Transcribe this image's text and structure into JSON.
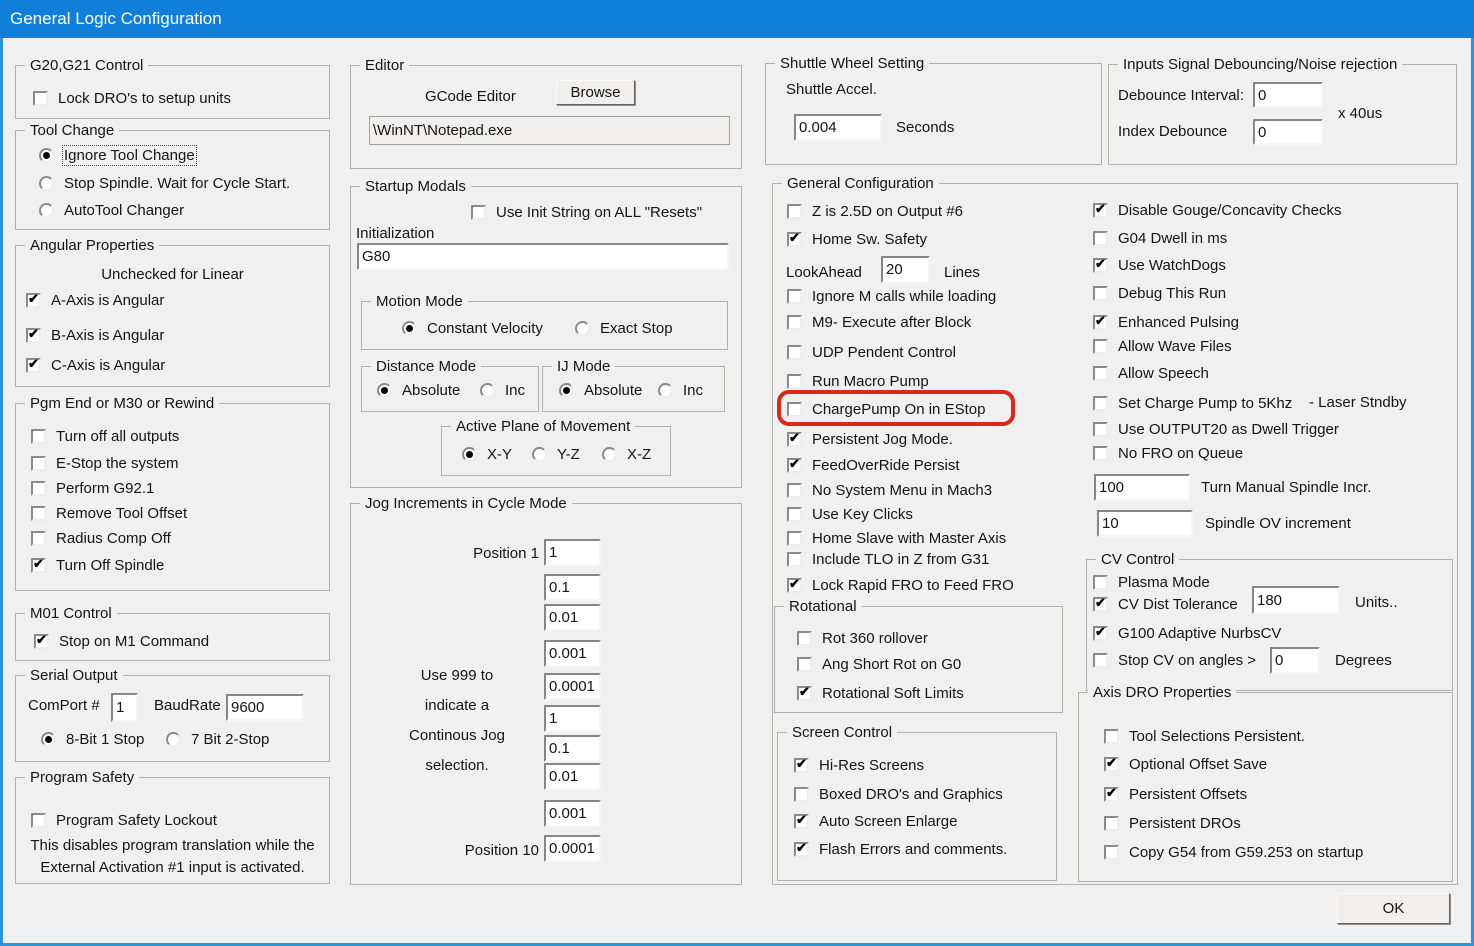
{
  "window": {
    "title": "General Logic Configuration",
    "ok_label": "OK"
  },
  "colors": {
    "titlebar_blue": "#0f7fd9",
    "window_border_blue": "#2e95d8",
    "highlight_red": "#da291c",
    "dialog_bg": "#f0f0f0"
  },
  "g20": {
    "title": "G20,G21 Control",
    "items": [
      {
        "label": "Lock DRO's to setup units",
        "checked": false
      }
    ]
  },
  "tool_change": {
    "title": "Tool Change",
    "options": [
      {
        "label": "Ignore Tool Change",
        "selected": true
      },
      {
        "label": "Stop Spindle. Wait for Cycle Start.",
        "selected": false
      },
      {
        "label": "AutoTool Changer",
        "selected": false
      }
    ]
  },
  "angular": {
    "title": "Angular Properties",
    "note": "Unchecked for Linear",
    "items": [
      {
        "label": "A-Axis is Angular",
        "checked": true
      },
      {
        "label": "B-Axis is Angular",
        "checked": true
      },
      {
        "label": "C-Axis is Angular",
        "checked": true
      }
    ]
  },
  "pgm_end": {
    "title": "Pgm End or M30 or Rewind",
    "items": [
      {
        "label": "Turn off all outputs",
        "checked": false
      },
      {
        "label": "E-Stop the system",
        "checked": false
      },
      {
        "label": "Perform G92.1",
        "checked": false
      },
      {
        "label": "Remove Tool Offset",
        "checked": false
      },
      {
        "label": "Radius Comp Off",
        "checked": false
      },
      {
        "label": "Turn Off Spindle",
        "checked": true
      }
    ]
  },
  "m01": {
    "title": "M01 Control",
    "items": [
      {
        "label": "Stop on M1 Command",
        "checked": true
      }
    ]
  },
  "serial": {
    "title": "Serial Output",
    "comport_label": "ComPort #",
    "comport_value": "1",
    "baud_label": "BaudRate",
    "baud_value": "9600",
    "options": [
      {
        "label": "8-Bit 1 Stop",
        "selected": true
      },
      {
        "label": "7 Bit 2-Stop",
        "selected": false
      }
    ]
  },
  "program_safety": {
    "title": "Program Safety",
    "items": [
      {
        "label": "Program Safety Lockout",
        "checked": false
      }
    ],
    "note_line1": "This disables program translation while the",
    "note_line2": "External Activation #1 input is activated."
  },
  "editor": {
    "title": "Editor",
    "gcode_label": "GCode Editor",
    "browse_label": "Browse",
    "path_value": "\\WinNT\\Notepad.exe"
  },
  "startup": {
    "title": "Startup Modals",
    "init_string": {
      "label": "Use Init String on ALL  \"Resets\"",
      "checked": false
    },
    "init_label": "Initialization",
    "init_value": "G80",
    "motion": {
      "title": "Motion Mode",
      "options": [
        {
          "label": "Constant Velocity",
          "selected": true
        },
        {
          "label": "Exact Stop",
          "selected": false
        }
      ]
    },
    "distance": {
      "title": "Distance Mode",
      "options": [
        {
          "label": "Absolute",
          "selected": true
        },
        {
          "label": "Inc",
          "selected": false
        }
      ]
    },
    "ij": {
      "title": "IJ Mode",
      "options": [
        {
          "label": "Absolute",
          "selected": true
        },
        {
          "label": "Inc",
          "selected": false
        }
      ]
    },
    "plane": {
      "title": "Active Plane of Movement",
      "options": [
        {
          "label": "X-Y",
          "selected": true
        },
        {
          "label": "Y-Z",
          "selected": false
        },
        {
          "label": "X-Z",
          "selected": false
        }
      ]
    }
  },
  "jog": {
    "title": "Jog Increments in Cycle Mode",
    "pos1_label": "Position 1",
    "pos10_label": "Position 10",
    "note_lines": [
      "Use 999 to",
      "indicate a",
      "Continous Jog",
      "selection."
    ],
    "values": [
      "1",
      "0.1",
      "0.01",
      "0.001",
      "0.0001",
      "1",
      "0.1",
      "0.01",
      "0.001",
      "0.0001"
    ]
  },
  "shuttle": {
    "title": "Shuttle Wheel Setting",
    "accel_label": "Shuttle Accel.",
    "value": "0.004",
    "unit": "Seconds"
  },
  "debounce": {
    "title": "Inputs Signal Debouncing/Noise rejection",
    "interval_label": "Debounce Interval:",
    "interval_value": "0",
    "unit": "x 40us",
    "index_label": "Index Debounce",
    "index_value": "0"
  },
  "gc": {
    "title": "General Configuration",
    "left": [
      {
        "label": "Z is 2.5D on Output #6",
        "checked": false
      },
      {
        "label": "Home Sw. Safety",
        "checked": true
      },
      {
        "label": "Ignore M calls while loading",
        "checked": false
      },
      {
        "label": "M9- Execute after Block",
        "checked": false
      },
      {
        "label": "UDP Pendent Control",
        "checked": false
      },
      {
        "label": "Run Macro Pump",
        "checked": false
      },
      {
        "label": "ChargePump On in EStop",
        "checked": false,
        "highlighted": true
      },
      {
        "label": "Persistent Jog Mode.",
        "checked": true
      },
      {
        "label": "FeedOverRide Persist",
        "checked": true
      },
      {
        "label": "No System Menu in Mach3",
        "checked": false
      },
      {
        "label": "Use Key Clicks",
        "checked": false
      },
      {
        "label": "Home Slave with Master Axis",
        "checked": false
      },
      {
        "label": "Include TLO in Z from G31",
        "checked": false
      },
      {
        "label": "Lock Rapid FRO to Feed FRO",
        "checked": true
      }
    ],
    "lookahead": {
      "label": "LookAhead",
      "value": "20",
      "unit": "Lines"
    },
    "right": [
      {
        "label": "Disable Gouge/Concavity Checks",
        "checked": true
      },
      {
        "label": "G04 Dwell in ms",
        "checked": false
      },
      {
        "label": "Use WatchDogs",
        "checked": true
      },
      {
        "label": "Debug This Run",
        "checked": false
      },
      {
        "label": "Enhanced Pulsing",
        "checked": true
      },
      {
        "label": "Allow Wave Files",
        "checked": false
      },
      {
        "label": "Allow Speech",
        "checked": false
      },
      {
        "label": "Set Charge Pump to 5Khz",
        "checked": false,
        "suffix": "- Laser Stndby"
      },
      {
        "label": "Use OUTPUT20 as Dwell Trigger",
        "checked": false
      },
      {
        "label": "No FRO on Queue",
        "checked": false
      }
    ],
    "spindle_incr": {
      "value": "100",
      "label": "Turn Manual Spindle Incr."
    },
    "spindle_ov": {
      "value": "10",
      "label": "Spindle OV increment"
    },
    "rotational": {
      "title": "Rotational",
      "items": [
        {
          "label": "Rot 360 rollover",
          "checked": false
        },
        {
          "label": "Ang Short Rot on G0",
          "checked": false
        },
        {
          "label": "Rotational Soft Limits",
          "checked": true
        }
      ]
    },
    "cv": {
      "title": "CV Control",
      "plasma": {
        "label": "Plasma Mode",
        "checked": false
      },
      "dist": {
        "label": "CV Dist Tolerance",
        "checked": true,
        "value": "180",
        "unit": "Units.."
      },
      "nurbs": {
        "label": "G100 Adaptive NurbsCV",
        "checked": true
      },
      "stop": {
        "label": "Stop CV on angles >",
        "checked": false,
        "value": "0",
        "unit": "Degrees"
      }
    },
    "axis_dro": {
      "title": "Axis DRO Properties",
      "items": [
        {
          "label": "Tool Selections Persistent.",
          "checked": false
        },
        {
          "label": "Optional Offset Save",
          "checked": true
        },
        {
          "label": "Persistent Offsets",
          "checked": true
        },
        {
          "label": "Persistent DROs",
          "checked": false
        },
        {
          "label": "Copy G54 from G59.253 on startup",
          "checked": false
        }
      ]
    }
  },
  "screen": {
    "title": "Screen Control",
    "items": [
      {
        "label": "Hi-Res Screens",
        "checked": true
      },
      {
        "label": "Boxed DRO's and Graphics",
        "checked": false
      },
      {
        "label": "Auto Screen Enlarge",
        "checked": true
      },
      {
        "label": "Flash Errors and comments.",
        "checked": true
      }
    ]
  }
}
